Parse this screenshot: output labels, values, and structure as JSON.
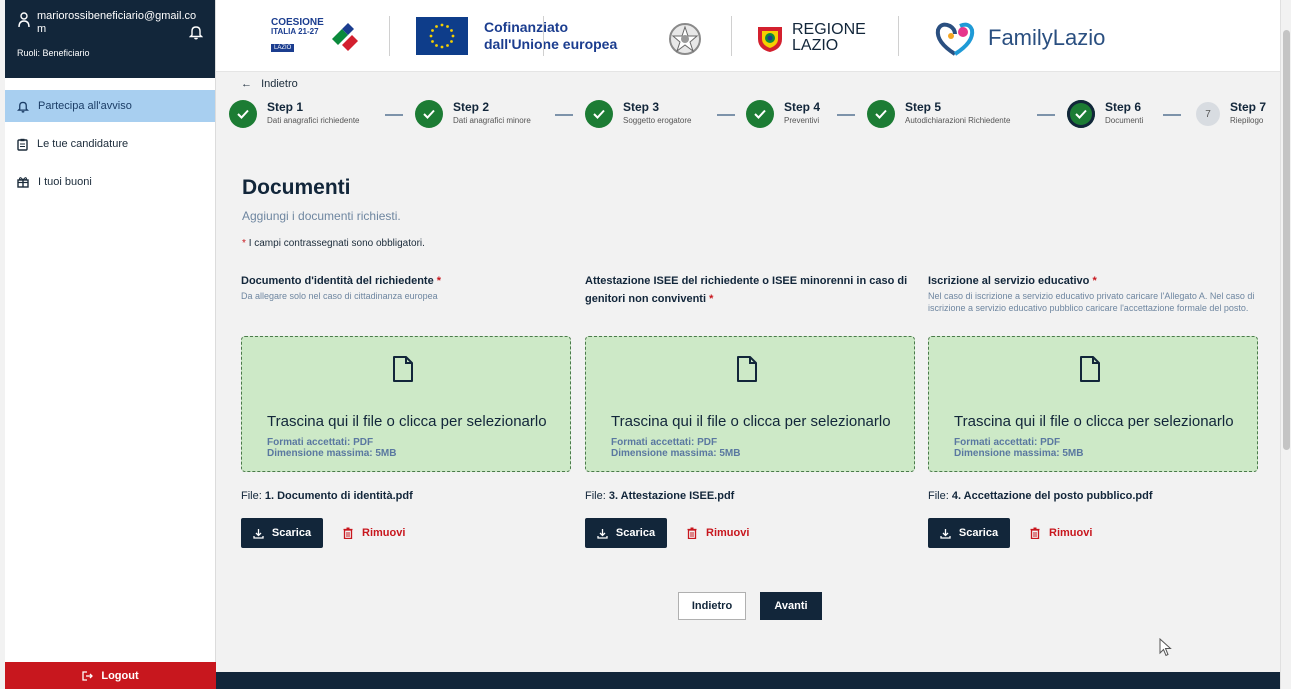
{
  "user": {
    "email": "mariorossibeneficiario@gmail.com",
    "roles": "Ruoli: Beneficiario"
  },
  "sidebar": {
    "items": [
      {
        "label": "Partecipa all'avviso"
      },
      {
        "label": "Le tue candidature"
      },
      {
        "label": "I tuoi buoni"
      }
    ],
    "logout": "Logout"
  },
  "header": {
    "coesione_line1": "COESIONE",
    "coesione_line2": "ITALIA 21-27",
    "coesione_tag": "LAZIO",
    "eu_line1": "Cofinanziato",
    "eu_line2": "dall'Unione europea",
    "regione_line1": "REGIONE",
    "regione_line2": "LAZIO",
    "family": "FamilyLazio"
  },
  "nav": {
    "back": "Indietro"
  },
  "steps": [
    {
      "title": "Step 1",
      "sub": "Dati anagrafici richiedente"
    },
    {
      "title": "Step 2",
      "sub": "Dati anagrafici minore"
    },
    {
      "title": "Step 3",
      "sub": "Soggetto erogatore"
    },
    {
      "title": "Step 4",
      "sub": "Preventivi"
    },
    {
      "title": "Step 5",
      "sub": "Autodichiarazioni Richiedente"
    },
    {
      "title": "Step 6",
      "sub": "Documenti"
    },
    {
      "title": "Step 7",
      "sub": "Riepilogo",
      "number": "7"
    }
  ],
  "page": {
    "title": "Documenti",
    "subtitle": "Aggiungi i documenti richiesti.",
    "required_note": "I campi contrassegnati sono obbligatori."
  },
  "dropzone": {
    "text": "Trascina qui il file o clicca per selezionarlo",
    "formats": "Formati accettati: PDF",
    "maxsize": "Dimensione massima: 5MB"
  },
  "documents": [
    {
      "label": "Documento d'identità del richiedente",
      "hint": "Da allegare solo nel caso di cittadinanza europea",
      "file_prefix": "File:",
      "file_name": "1. Documento di identità.pdf"
    },
    {
      "label": "Attestazione ISEE del richiedente o ISEE minorenni in caso di genitori non conviventi",
      "hint": "",
      "file_prefix": "File:",
      "file_name": "3. Attestazione ISEE.pdf"
    },
    {
      "label": "Iscrizione al servizio educativo",
      "hint": "Nel caso di iscrizione a servizio educativo privato caricare l'Allegato A. Nel caso di iscrizione a servizio educativo pubblico caricare l'accettazione formale del posto.",
      "file_prefix": "File:",
      "file_name": "4. Accettazione del posto pubblico.pdf"
    }
  ],
  "actions": {
    "download": "Scarica",
    "remove": "Rimuovi"
  },
  "buttons": {
    "back": "Indietro",
    "next": "Avanti"
  },
  "colors": {
    "primary": "#12263a",
    "success": "#1c7c34",
    "danger": "#c8171e",
    "dropzone": "#cde9c7",
    "sidebar_active": "#a8cff0"
  }
}
